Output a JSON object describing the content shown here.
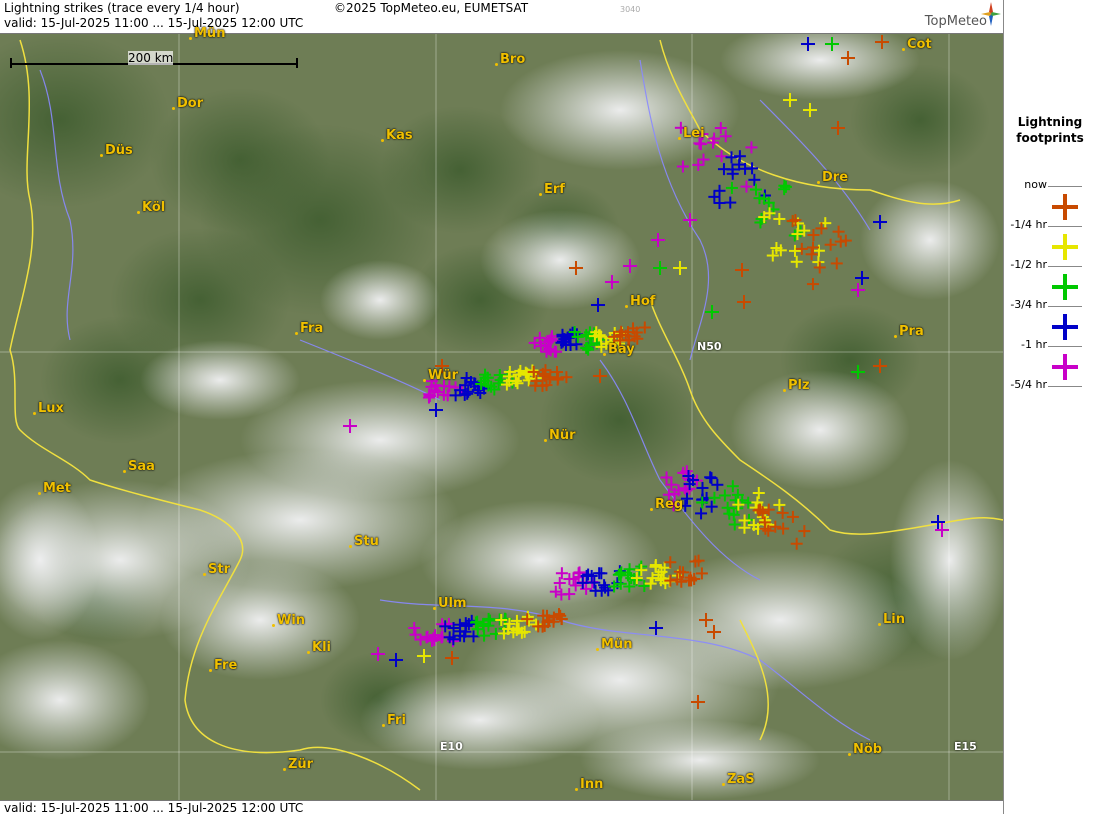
{
  "header": {
    "title": "Lightning strikes (trace every 1/4 hour)",
    "copyright": "©2025 TopMeteo.eu, EUMETSAT",
    "valid": "valid:  15-Jul-2025 11:00 ... 15-Jul-2025 12:00 UTC",
    "code": "3040",
    "brand": "TopMeteo"
  },
  "footer": {
    "valid": "valid:  15-Jul-2025 11:00 ... 15-Jul-2025 12:00 UTC"
  },
  "scale": {
    "label": "200 km"
  },
  "grid_labels": {
    "n50": "N50",
    "e10": "E10",
    "e15": "E15"
  },
  "cities": [
    {
      "id": "mun-top",
      "label": "Mün"
    },
    {
      "id": "bro",
      "label": "Bro"
    },
    {
      "id": "cot",
      "label": "Cot"
    },
    {
      "id": "dor",
      "label": "Dor"
    },
    {
      "id": "kas",
      "label": "Kas"
    },
    {
      "id": "lei",
      "label": "Lei"
    },
    {
      "id": "dus",
      "label": "Düs"
    },
    {
      "id": "dre",
      "label": "Dre"
    },
    {
      "id": "erf",
      "label": "Erf"
    },
    {
      "id": "kol",
      "label": "Köl"
    },
    {
      "id": "hof",
      "label": "Hof"
    },
    {
      "id": "fra",
      "label": "Fra"
    },
    {
      "id": "pra",
      "label": "Pra"
    },
    {
      "id": "bay",
      "label": "Bay"
    },
    {
      "id": "wur",
      "label": "Wür"
    },
    {
      "id": "plz",
      "label": "Plz"
    },
    {
      "id": "lux",
      "label": "Lux"
    },
    {
      "id": "nur",
      "label": "Nür"
    },
    {
      "id": "saa",
      "label": "Saa"
    },
    {
      "id": "met",
      "label": "Met"
    },
    {
      "id": "reg",
      "label": "Reg"
    },
    {
      "id": "stu",
      "label": "Stu"
    },
    {
      "id": "str",
      "label": "Str"
    },
    {
      "id": "ulm",
      "label": "Ulm"
    },
    {
      "id": "win",
      "label": "Win"
    },
    {
      "id": "lin",
      "label": "Lin"
    },
    {
      "id": "kli",
      "label": "Kli"
    },
    {
      "id": "mun",
      "label": "Mün"
    },
    {
      "id": "fre",
      "label": "Fre"
    },
    {
      "id": "fri",
      "label": "Fri"
    },
    {
      "id": "nob",
      "label": "Nöb"
    },
    {
      "id": "zur",
      "label": "Zür"
    },
    {
      "id": "inn",
      "label": "Inn"
    },
    {
      "id": "zas",
      "label": "ZaS"
    }
  ],
  "legend": {
    "title_line1": "Lightning",
    "title_line2": "footprints",
    "items": [
      {
        "label": "now",
        "color": null
      },
      {
        "label": "-1/4 hr",
        "color": "#c84a00"
      },
      {
        "label": "-1/2 hr",
        "color": "#e6e600"
      },
      {
        "label": "-3/4 hr",
        "color": "#00c800"
      },
      {
        "label": "-1 hr",
        "color": "#0000c8"
      },
      {
        "label": "-5/4 hr",
        "color": "#c800c8"
      }
    ]
  },
  "colors": {
    "q1": "#c84a00",
    "q2": "#e6e600",
    "q3": "#00c800",
    "q4": "#0000c8",
    "q5": "#c800c8",
    "city_label": "#f0c000",
    "border": "#f0e040",
    "river": "#8080ff"
  }
}
